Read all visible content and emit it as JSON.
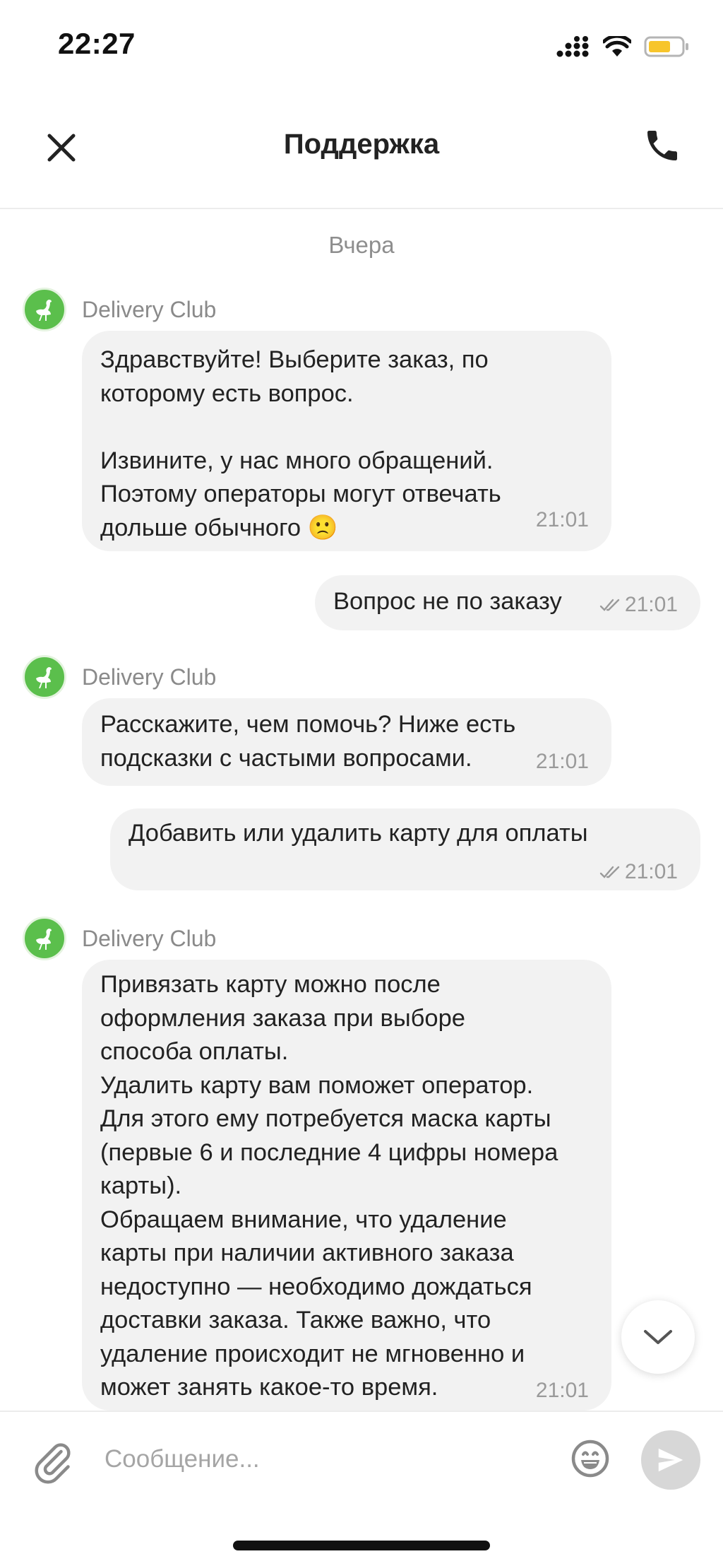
{
  "status_bar": {
    "time": "22:27",
    "icons": [
      "signal-icon",
      "wifi-icon",
      "battery-icon"
    ]
  },
  "header": {
    "title": "Поддержка",
    "close_icon": "close-icon",
    "call_icon": "phone-icon"
  },
  "chat": {
    "date_separator": "Вчера",
    "messages": [
      {
        "direction": "incoming",
        "sender": "Delivery Club",
        "text": "Здравствуйте! Выберите заказ, по\nкоторому есть вопрос.\n\nИзвините, у нас много обращений.\nПоэтому операторы могут отвечать\nдольше обычного 🙁",
        "time": "21:01"
      },
      {
        "direction": "outgoing",
        "text": "Вопрос не по заказу",
        "time": "21:01",
        "status": "read"
      },
      {
        "direction": "incoming",
        "sender": "Delivery Club",
        "text": "Расскажите, чем помочь? Ниже есть\nподсказки с частыми вопросами.",
        "time": "21:01"
      },
      {
        "direction": "outgoing",
        "text": "Добавить или удалить карту для оплаты",
        "time": "21:01",
        "status": "read"
      },
      {
        "direction": "incoming",
        "sender": "Delivery Club",
        "text": "Привязать карту можно после\nоформления заказа при выборе\nспособа оплаты.\nУдалить карту вам поможет оператор.\nДля этого ему потребуется маска карты\n(первые 6 и последние 4 цифры номера\nкарты).\nОбращаем внимание, что удаление\nкарты при наличии активного заказа\nнедоступно — необходимо дождаться\nдоставки заказа. Также важно, что\nудаление происходит не мгновенно и\nможет занять какое-то время.",
        "time": "21:01"
      }
    ]
  },
  "input_bar": {
    "placeholder": "Сообщение...",
    "value": ""
  },
  "colors": {
    "avatar_green": "#5bbf4c",
    "bubble_gray": "#f2f2f2",
    "battery_yellow": "#f7c52b"
  }
}
